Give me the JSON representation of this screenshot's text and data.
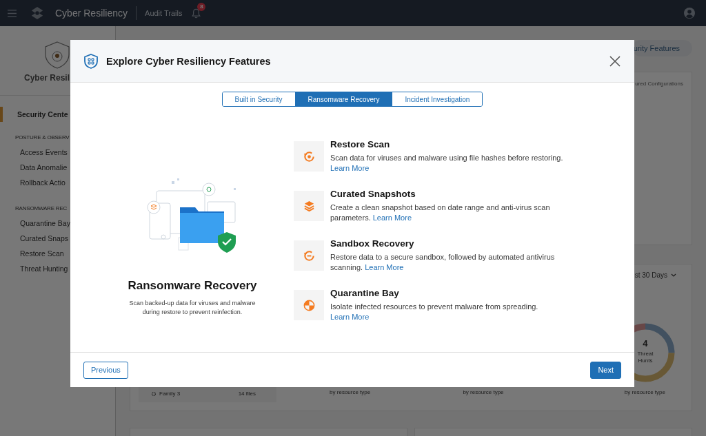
{
  "top_bar": {
    "title": "Cyber Resiliency",
    "link": "Audit Trails",
    "notification_count": "8"
  },
  "sidebar": {
    "heading": "Cyber Resil",
    "items": [
      {
        "label": "Security Cente",
        "selected": true
      }
    ],
    "sections": [
      {
        "title": "POSTURE & OBSERV",
        "items": [
          {
            "label": "Access Events",
            "selected": false
          },
          {
            "label": "Data Anomalie",
            "selected": false
          },
          {
            "label": "Rollback Actio",
            "selected": false
          }
        ]
      },
      {
        "title": "RANSOMWARE REC",
        "items": [
          {
            "label": "Quarantine Bay",
            "selected": false
          },
          {
            "label": "Curated Snaps",
            "selected": false
          },
          {
            "label": "Restore Scan",
            "selected": false
          },
          {
            "label": "Threat Hunting",
            "selected": false
          }
        ]
      }
    ]
  },
  "background": {
    "pill": "urity Features",
    "card_header": "ured Configurations",
    "period": "st 30 Days",
    "donut": {
      "value": "4",
      "label": "Threat Hunts"
    },
    "family": {
      "name": "Family 3",
      "count": "14 files"
    },
    "captions": [
      "by resource type",
      "by resource type",
      "by resource type"
    ]
  },
  "dialog": {
    "title": "Explore Cyber Resiliency Features",
    "tabs": [
      {
        "label": "Built in Security",
        "selected": false
      },
      {
        "label": "Ransomware Recovery",
        "selected": true
      },
      {
        "label": "Incident Investigation",
        "selected": false
      }
    ],
    "feature": {
      "title": "Ransomware Recovery",
      "description": "Scan backed-up data for viruses and malware during restore to prevent reinfection."
    },
    "items": [
      {
        "kind": "scan",
        "title": "Restore Scan",
        "description": "Scan data for viruses and malware using file hashes before restoring.",
        "link": "Learn More"
      },
      {
        "kind": "layers",
        "title": "Curated Snapshots",
        "description": "Create a clean snapshot based on date range and anti-virus scan parameters.",
        "link": "Learn More"
      },
      {
        "kind": "sandbox",
        "title": "Sandbox Recovery",
        "description": "Restore data to a secure sandbox, followed by automated antivirus scanning.",
        "link": "Learn More"
      },
      {
        "kind": "quarantine",
        "title": "Quarantine Bay",
        "description": "Isolate infected resources to prevent malware from spreading.",
        "link": "Learn More"
      }
    ],
    "buttons": {
      "previous": "Previous",
      "next": "Next"
    }
  }
}
